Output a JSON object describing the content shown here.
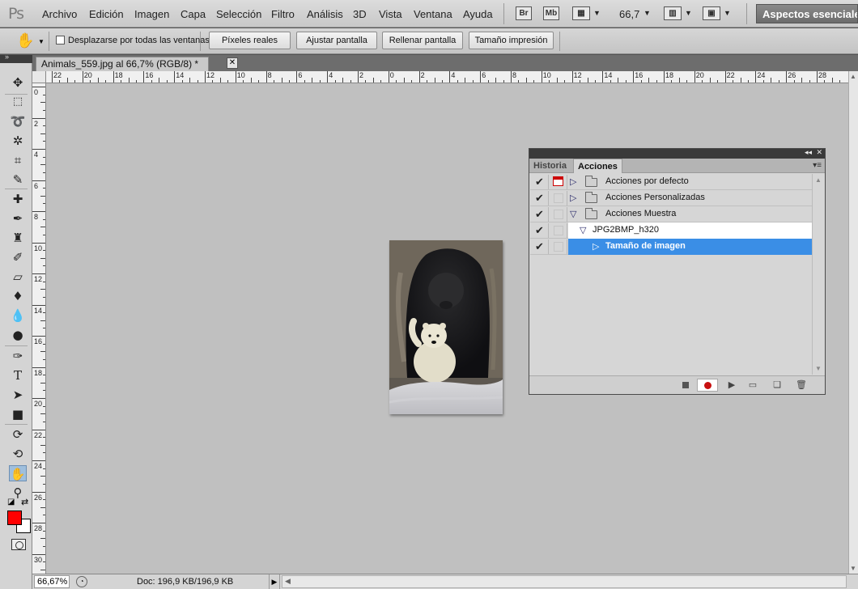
{
  "menubar": {
    "logo": "Ps",
    "items": [
      "Archivo",
      "Edición",
      "Imagen",
      "Capa",
      "Selección",
      "Filtro",
      "Análisis",
      "3D",
      "Vista",
      "Ventana",
      "Ayuda"
    ],
    "bridge": "Br",
    "minibridge": "Mb",
    "zoom": "66,7",
    "workspace": "Aspectos esenciales"
  },
  "options": {
    "scroll_all_label": "Desplazarse por todas las ventanas",
    "scroll_all_checked": false,
    "buttons": [
      "Píxeles reales",
      "Ajustar pantalla",
      "Rellenar pantalla",
      "Tamaño impresión"
    ]
  },
  "document": {
    "tab_title": "Animals_559.jpg al 66,7% (RGB/8) *"
  },
  "rulers": {
    "horizontal": [
      "22",
      "20",
      "18",
      "16",
      "14",
      "12",
      "10",
      "8",
      "6",
      "4",
      "2",
      "0",
      "2",
      "4",
      "6",
      "8",
      "10",
      "12",
      "14",
      "16",
      "18",
      "20",
      "22",
      "24",
      "26",
      "28"
    ],
    "vertical": [
      "0",
      "2",
      "4",
      "6",
      "8",
      "10",
      "12",
      "14",
      "16",
      "18",
      "20",
      "22",
      "24",
      "26",
      "28",
      "30"
    ]
  },
  "panel": {
    "tabs": [
      "Historia",
      "Acciones"
    ],
    "active_tab": "Acciones",
    "actions": [
      {
        "label": "Acciones por defecto",
        "checked": true,
        "dialog": true,
        "kind": "set",
        "expanded": false
      },
      {
        "label": "Acciones Personalizadas",
        "checked": true,
        "dialog": false,
        "kind": "set",
        "expanded": false
      },
      {
        "label": "Acciones Muestra",
        "checked": true,
        "dialog": false,
        "kind": "set",
        "expanded": true
      },
      {
        "label": "JPG2BMP_h320",
        "checked": true,
        "dialog": false,
        "kind": "action",
        "expanded": true
      },
      {
        "label": "Tamaño de imagen",
        "checked": true,
        "dialog": false,
        "kind": "step",
        "selected": true
      }
    ]
  },
  "status": {
    "zoom": "66,67%",
    "doc_info": "Doc: 196,9 KB/196,9 KB"
  },
  "colors": {
    "foreground": "#ff0000",
    "background": "#ffffff",
    "selection": "#3a8ee6"
  },
  "tools": [
    "move-tool",
    "marquee-tool",
    "lasso-tool",
    "quick-selection-tool",
    "crop-tool",
    "eyedropper-tool",
    "spot-healing-tool",
    "brush-tool",
    "clone-stamp-tool",
    "history-brush-tool",
    "eraser-tool",
    "paint-bucket-tool",
    "blur-tool",
    "dodge-tool",
    "pen-tool",
    "type-tool",
    "path-selection-tool",
    "rectangle-tool",
    "3d-rotate-tool",
    "3d-orbit-tool",
    "hand-tool",
    "zoom-tool"
  ]
}
